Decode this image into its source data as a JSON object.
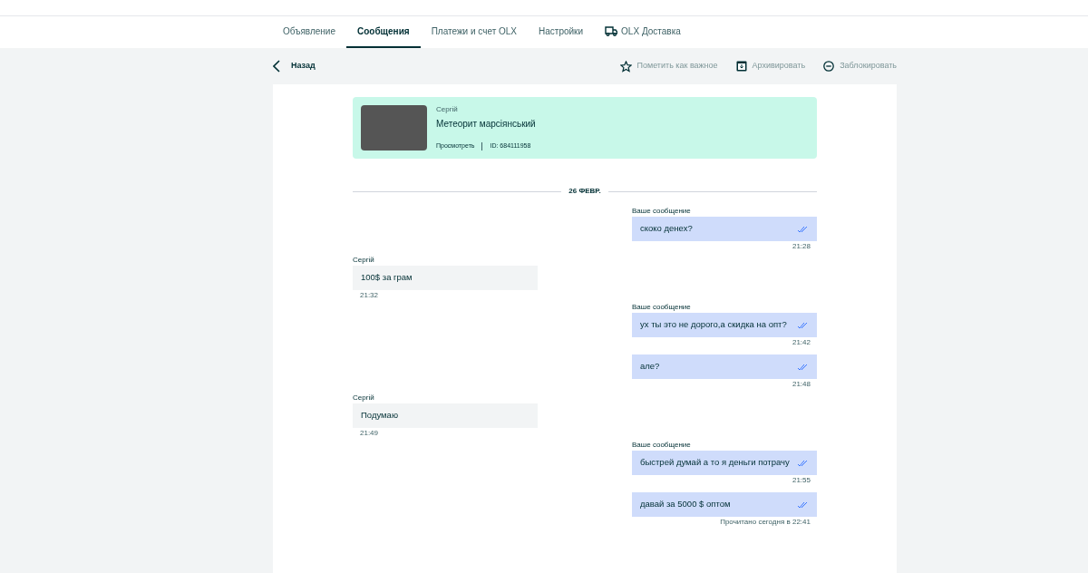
{
  "tabs": [
    {
      "label": "Объявление",
      "selected": false,
      "icon": false
    },
    {
      "label": "Сообщения",
      "selected": true,
      "icon": false
    },
    {
      "label": "Платежи и счет OLX",
      "selected": false,
      "icon": false
    },
    {
      "label": "Настройки",
      "selected": false,
      "icon": false
    },
    {
      "label": "OLX Доставка",
      "selected": false,
      "icon": true
    }
  ],
  "toolbar": {
    "back": "Назад",
    "actions": [
      {
        "kind": "star",
        "label": "Пометить как важное"
      },
      {
        "kind": "archive",
        "label": "Архивировать"
      },
      {
        "kind": "block",
        "label": "Заблокировать"
      }
    ]
  },
  "ad": {
    "seller": "Сергій",
    "title": "Метеорит марсіянський",
    "view_link": "Просмотреть",
    "id": "ID: 684111958"
  },
  "date": "26 ФЕВР.",
  "groups": [
    {
      "kind": "own",
      "label": "Ваше сообщение",
      "messages": [
        {
          "text": "скоко денех?",
          "time": "21:28"
        }
      ]
    },
    {
      "kind": "other",
      "label": "Сергій",
      "messages": [
        {
          "text": "100$ за грам",
          "time": "21:32"
        }
      ]
    },
    {
      "kind": "own",
      "label": "Ваше сообщение",
      "messages": [
        {
          "text": "ух ты это не дорого,а скидка на опт?",
          "time": "21:42"
        },
        {
          "text": "але?",
          "time": "21:48"
        }
      ]
    },
    {
      "kind": "other",
      "label": "Сергій",
      "messages": [
        {
          "text": "Подумаю",
          "time": "21:49"
        }
      ]
    },
    {
      "kind": "own",
      "label": "Ваше сообщение",
      "messages": [
        {
          "text": "быстрей думай а то я деньги потрачу",
          "time": "21:55"
        },
        {
          "text": "давай за 5000 $ оптом",
          "time": "Прочитано сегодня в 22:41"
        }
      ]
    }
  ]
}
